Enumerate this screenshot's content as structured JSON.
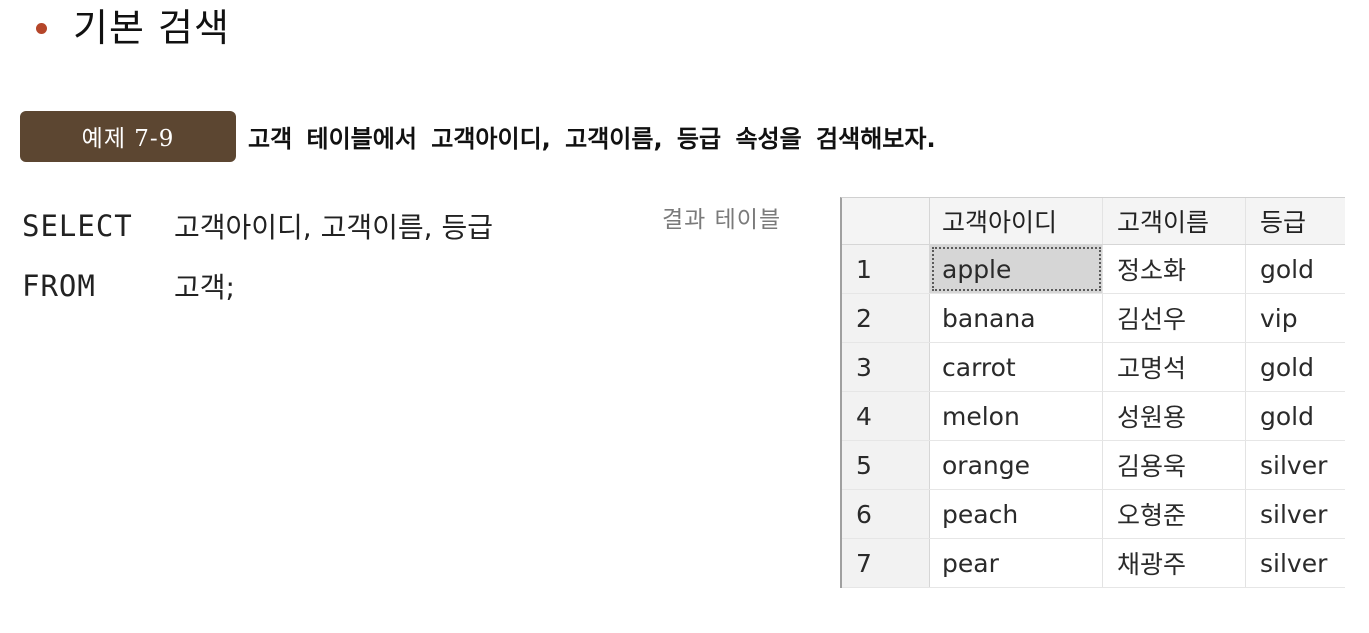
{
  "heading": {
    "text": "기본 검색",
    "bullet_color": "#b5462a"
  },
  "example": {
    "badge": "예제 7-9",
    "badge_color": "#5c4631",
    "text": "고객 테이블에서 고객아이디, 고객이름, 등급 속성을 검색해보자."
  },
  "sql": {
    "lines": [
      {
        "keyword": "SELECT",
        "args": "고객아이디, 고객이름, 등급"
      },
      {
        "keyword": "FROM",
        "args": "고객;"
      }
    ]
  },
  "result": {
    "caption": "결과 테이블",
    "columns": [
      "",
      "고객아이디",
      "고객이름",
      "등급"
    ],
    "rows": [
      {
        "num": "1",
        "id": "apple",
        "name": "정소화",
        "grade": "gold"
      },
      {
        "num": "2",
        "id": "banana",
        "name": "김선우",
        "grade": "vip"
      },
      {
        "num": "3",
        "id": "carrot",
        "name": "고명석",
        "grade": "gold"
      },
      {
        "num": "4",
        "id": "melon",
        "name": "성원용",
        "grade": "gold"
      },
      {
        "num": "5",
        "id": "orange",
        "name": "김용욱",
        "grade": "silver"
      },
      {
        "num": "6",
        "id": "peach",
        "name": "오형준",
        "grade": "silver"
      },
      {
        "num": "7",
        "id": "pear",
        "name": "채광주",
        "grade": "silver"
      }
    ]
  }
}
